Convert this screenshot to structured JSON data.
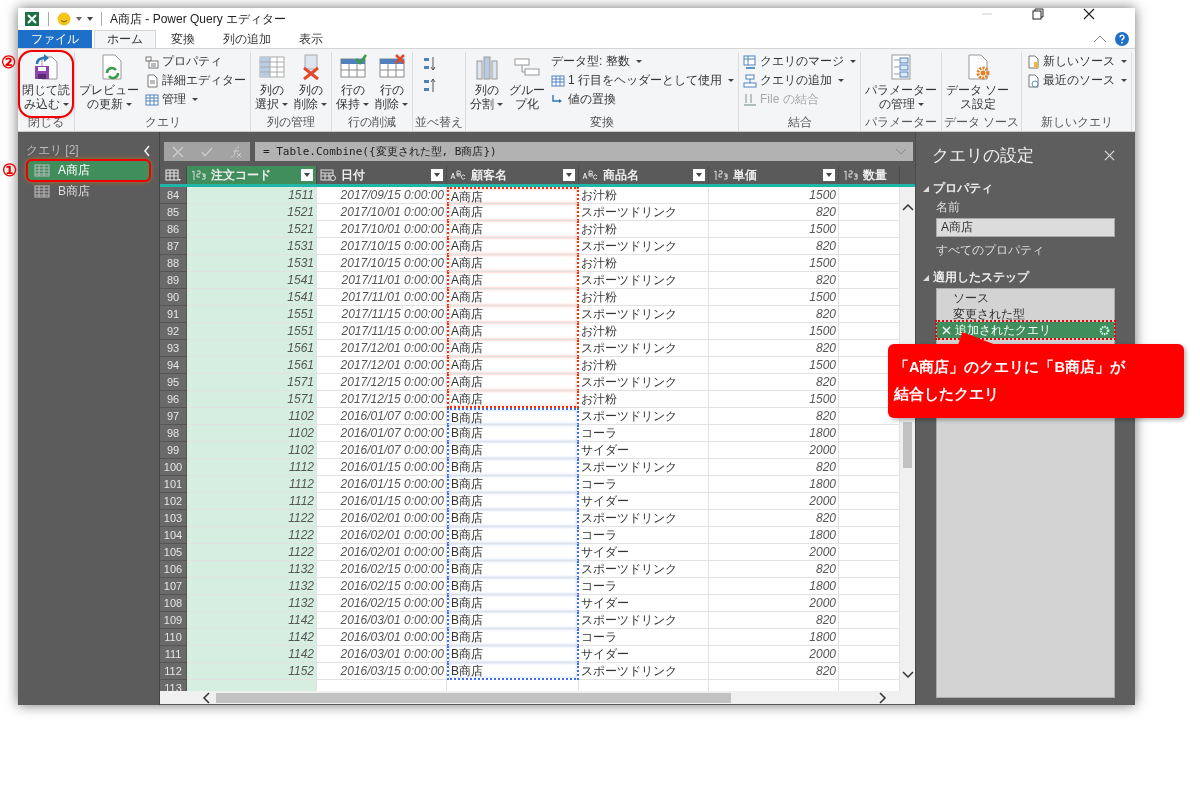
{
  "window": {
    "title": "A商店 - Power Query エディター"
  },
  "tabs": [
    {
      "label": "ファイル",
      "kind": "file",
      "selected": false
    },
    {
      "label": "ホーム",
      "kind": "tab",
      "selected": true
    },
    {
      "label": "変換",
      "kind": "tab",
      "selected": false
    },
    {
      "label": "列の追加",
      "kind": "tab",
      "selected": false
    },
    {
      "label": "表示",
      "kind": "tab",
      "selected": false
    }
  ],
  "ribbon": {
    "groups": [
      {
        "label": "閉じる",
        "kind": "standard",
        "columns": [
          [
            {
              "lines": [
                "閉じて読",
                "み込む"
              ],
              "kind": "large",
              "dropdown": true,
              "highlighted": true,
              "marker": "②"
            }
          ]
        ]
      },
      {
        "label": "クエリ",
        "kind": "standard",
        "columns": [
          [
            {
              "lines": [
                "プレビュー",
                "の更新"
              ],
              "kind": "large",
              "dropdown": true
            }
          ],
          [
            {
              "lines": [
                "プロパティ"
              ],
              "kind": "small",
              "dropdown": false
            },
            {
              "lines": [
                "詳細エディター"
              ],
              "kind": "small",
              "dropdown": false
            },
            {
              "lines": [
                "管理"
              ],
              "kind": "small",
              "dropdown": true
            }
          ]
        ]
      },
      {
        "label": "列の管理",
        "kind": "standard",
        "columns": [
          [
            {
              "lines": [
                "列の",
                "選択"
              ],
              "kind": "large",
              "dropdown": true
            }
          ],
          [
            {
              "lines": [
                "列の",
                "削除"
              ],
              "kind": "large",
              "dropdown": true
            }
          ]
        ]
      },
      {
        "label": "行の削減",
        "kind": "standard",
        "columns": [
          [
            {
              "lines": [
                "行の",
                "保持"
              ],
              "kind": "large",
              "dropdown": true
            }
          ],
          [
            {
              "lines": [
                "行の",
                "削除"
              ],
              "kind": "large",
              "dropdown": true
            }
          ]
        ]
      },
      {
        "label": "並べ替え",
        "kind": "sort"
      },
      {
        "label": "変換",
        "kind": "standard",
        "columns": [
          [
            {
              "lines": [
                "列の",
                "分割"
              ],
              "kind": "large",
              "dropdown": true
            }
          ],
          [
            {
              "lines": [
                "グルー",
                "プ化"
              ],
              "kind": "large",
              "dropdown": false
            }
          ],
          [
            {
              "lines": [
                "データ型: 整数"
              ],
              "kind": "small",
              "dropdown": true
            },
            {
              "lines": [
                "1 行目をヘッダーとして使用"
              ],
              "kind": "small",
              "dropdown": true
            },
            {
              "lines": [
                "値の置換"
              ],
              "kind": "small",
              "dropdown": false
            }
          ]
        ]
      },
      {
        "label": "結合",
        "kind": "standard",
        "columns": [
          [
            {
              "lines": [
                "クエリのマージ"
              ],
              "kind": "small",
              "dropdown": true
            },
            {
              "lines": [
                "クエリの追加"
              ],
              "kind": "small",
              "dropdown": true
            },
            {
              "lines": [
                "File の結合"
              ],
              "kind": "small",
              "dropdown": false,
              "disabled": true
            }
          ]
        ]
      },
      {
        "label": "パラメーター",
        "kind": "standard",
        "columns": [
          [
            {
              "lines": [
                "パラメーター",
                "の管理"
              ],
              "kind": "large",
              "dropdown": true
            }
          ]
        ]
      },
      {
        "label": "データ ソース",
        "kind": "standard",
        "columns": [
          [
            {
              "lines": [
                "データ ソー",
                "ス設定"
              ],
              "kind": "large",
              "dropdown": false
            }
          ]
        ]
      },
      {
        "label": "新しいクエリ",
        "kind": "standard",
        "columns": [
          [
            {
              "lines": [
                "新しいソース"
              ],
              "kind": "small",
              "dropdown": true
            },
            {
              "lines": [
                "最近のソース"
              ],
              "kind": "small",
              "dropdown": true
            }
          ]
        ]
      }
    ]
  },
  "queries": {
    "title": "クエリ [2]",
    "items": [
      {
        "label": "A商店",
        "selected": true,
        "highlighted": true,
        "marker": "①"
      },
      {
        "label": "B商店",
        "selected": false,
        "highlighted": false
      }
    ]
  },
  "formula": "= Table.Combine({変更された型, B商店})",
  "table": {
    "columns": [
      {
        "name": "注文コード",
        "kind": "number",
        "selected": true,
        "filter_button": true
      },
      {
        "name": "日付",
        "kind": "date",
        "selected": false,
        "filter_button": true
      },
      {
        "name": "顧客名",
        "kind": "text",
        "selected": false,
        "filter_button": true
      },
      {
        "name": "商品名",
        "kind": "text",
        "selected": false,
        "filter_button": true
      },
      {
        "name": "単価",
        "kind": "number",
        "selected": false,
        "filter_button": true
      },
      {
        "name": "数量",
        "kind": "number",
        "selected": false,
        "filter_button": false
      }
    ],
    "rows": [
      {
        "index": "84",
        "code": "1511",
        "date": "2017/09/15 0:00:00",
        "customer": "A商店",
        "product": "お汁粉",
        "price": "1500",
        "color": "#ff2a00"
      },
      {
        "index": "85",
        "code": "1521",
        "date": "2017/10/01 0:00:00",
        "customer": "A商店",
        "product": "スポーツドリンク",
        "price": "820",
        "color": "#ff2a00"
      },
      {
        "index": "86",
        "code": "1521",
        "date": "2017/10/01 0:00:00",
        "customer": "A商店",
        "product": "お汁粉",
        "price": "1500",
        "color": "#ff2a00"
      },
      {
        "index": "87",
        "code": "1531",
        "date": "2017/10/15 0:00:00",
        "customer": "A商店",
        "product": "スポーツドリンク",
        "price": "820",
        "color": "#ff2a00"
      },
      {
        "index": "88",
        "code": "1531",
        "date": "2017/10/15 0:00:00",
        "customer": "A商店",
        "product": "お汁粉",
        "price": "1500",
        "color": "#ff2a00"
      },
      {
        "index": "89",
        "code": "1541",
        "date": "2017/11/01 0:00:00",
        "customer": "A商店",
        "product": "スポーツドリンク",
        "price": "820",
        "color": "#ff2a00"
      },
      {
        "index": "90",
        "code": "1541",
        "date": "2017/11/01 0:00:00",
        "customer": "A商店",
        "product": "お汁粉",
        "price": "1500",
        "color": "#ff2a00"
      },
      {
        "index": "91",
        "code": "1551",
        "date": "2017/11/15 0:00:00",
        "customer": "A商店",
        "product": "スポーツドリンク",
        "price": "820",
        "color": "#ff2a00"
      },
      {
        "index": "92",
        "code": "1551",
        "date": "2017/11/15 0:00:00",
        "customer": "A商店",
        "product": "お汁粉",
        "price": "1500",
        "color": "#ff2a00"
      },
      {
        "index": "93",
        "code": "1561",
        "date": "2017/12/01 0:00:00",
        "customer": "A商店",
        "product": "スポーツドリンク",
        "price": "820",
        "color": "#ff2a00"
      },
      {
        "index": "94",
        "code": "1561",
        "date": "2017/12/01 0:00:00",
        "customer": "A商店",
        "product": "お汁粉",
        "price": "1500",
        "color": "#ff2a00"
      },
      {
        "index": "95",
        "code": "1571",
        "date": "2017/12/15 0:00:00",
        "customer": "A商店",
        "product": "スポーツドリンク",
        "price": "820",
        "color": "#ff2a00"
      },
      {
        "index": "96",
        "code": "1571",
        "date": "2017/12/15 0:00:00",
        "customer": "A商店",
        "product": "お汁粉",
        "price": "1500",
        "color": "#ff2a00"
      },
      {
        "index": "97",
        "code": "1102",
        "date": "2016/01/07 0:00:00",
        "customer": "B商店",
        "product": "スポーツドリンク",
        "price": "820",
        "color": "#3a6df0"
      },
      {
        "index": "98",
        "code": "1102",
        "date": "2016/01/07 0:00:00",
        "customer": "B商店",
        "product": "コーラ",
        "price": "1800",
        "color": "#3a6df0"
      },
      {
        "index": "99",
        "code": "1102",
        "date": "2016/01/07 0:00:00",
        "customer": "B商店",
        "product": "サイダー",
        "price": "2000",
        "color": "#3a6df0"
      },
      {
        "index": "100",
        "code": "1112",
        "date": "2016/01/15 0:00:00",
        "customer": "B商店",
        "product": "スポーツドリンク",
        "price": "820",
        "color": "#3a6df0"
      },
      {
        "index": "101",
        "code": "1112",
        "date": "2016/01/15 0:00:00",
        "customer": "B商店",
        "product": "コーラ",
        "price": "1800",
        "color": "#3a6df0"
      },
      {
        "index": "102",
        "code": "1112",
        "date": "2016/01/15 0:00:00",
        "customer": "B商店",
        "product": "サイダー",
        "price": "2000",
        "color": "#3a6df0"
      },
      {
        "index": "103",
        "code": "1122",
        "date": "2016/02/01 0:00:00",
        "customer": "B商店",
        "product": "スポーツドリンク",
        "price": "820",
        "color": "#3a6df0"
      },
      {
        "index": "104",
        "code": "1122",
        "date": "2016/02/01 0:00:00",
        "customer": "B商店",
        "product": "コーラ",
        "price": "1800",
        "color": "#3a6df0"
      },
      {
        "index": "105",
        "code": "1122",
        "date": "2016/02/01 0:00:00",
        "customer": "B商店",
        "product": "サイダー",
        "price": "2000",
        "color": "#3a6df0"
      },
      {
        "index": "106",
        "code": "1132",
        "date": "2016/02/15 0:00:00",
        "customer": "B商店",
        "product": "スポーツドリンク",
        "price": "820",
        "color": "#3a6df0"
      },
      {
        "index": "107",
        "code": "1132",
        "date": "2016/02/15 0:00:00",
        "customer": "B商店",
        "product": "コーラ",
        "price": "1800",
        "color": "#3a6df0"
      },
      {
        "index": "108",
        "code": "1132",
        "date": "2016/02/15 0:00:00",
        "customer": "B商店",
        "product": "サイダー",
        "price": "2000",
        "color": "#3a6df0"
      },
      {
        "index": "109",
        "code": "1142",
        "date": "2016/03/01 0:00:00",
        "customer": "B商店",
        "product": "スポーツドリンク",
        "price": "820",
        "color": "#3a6df0"
      },
      {
        "index": "110",
        "code": "1142",
        "date": "2016/03/01 0:00:00",
        "customer": "B商店",
        "product": "コーラ",
        "price": "1800",
        "color": "#3a6df0"
      },
      {
        "index": "111",
        "code": "1142",
        "date": "2016/03/01 0:00:00",
        "customer": "B商店",
        "product": "サイダー",
        "price": "2000",
        "color": "#3a6df0"
      },
      {
        "index": "112",
        "code": "1152",
        "date": "2016/03/15 0:00:00",
        "customer": "B商店",
        "product": "スポーツドリンク",
        "price": "820",
        "color": "#3a6df0"
      },
      {
        "index": "113"
      }
    ]
  },
  "settings": {
    "title": "クエリの設定",
    "properties_heading": "プロパティ",
    "name_label": "名前",
    "name_value": "A商店",
    "all_properties": "すべてのプロパティ",
    "steps_heading": "適用したステップ",
    "steps": [
      {
        "label": "ソース",
        "selected": false,
        "highlighted": false
      },
      {
        "label": "変更された型",
        "selected": false,
        "highlighted": false
      },
      {
        "label": "追加されたクエリ",
        "selected": true,
        "highlighted": true
      }
    ]
  },
  "callout": {
    "lines": [
      "「A商店」のクエリに「B商店」が",
      "結合したクエリ"
    ]
  }
}
